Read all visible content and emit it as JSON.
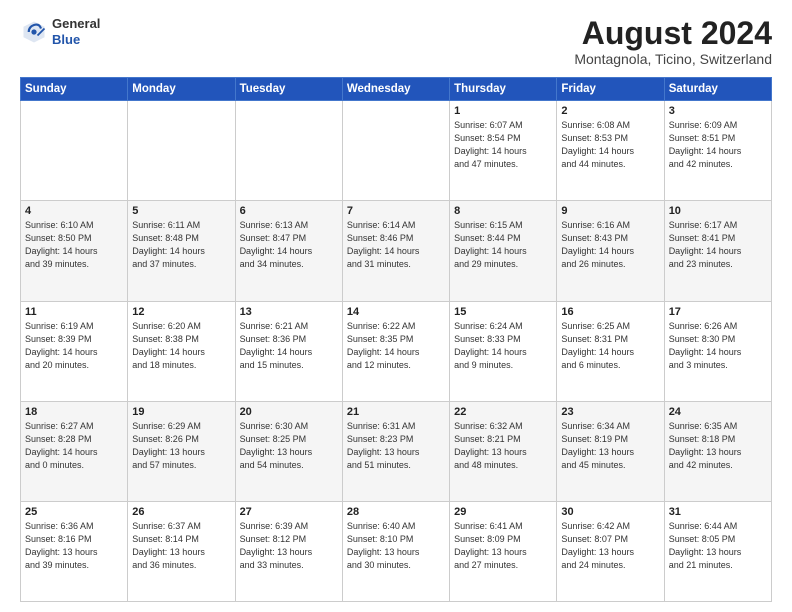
{
  "header": {
    "logo_general": "General",
    "logo_blue": "Blue",
    "month_title": "August 2024",
    "location": "Montagnola, Ticino, Switzerland"
  },
  "days_of_week": [
    "Sunday",
    "Monday",
    "Tuesday",
    "Wednesday",
    "Thursday",
    "Friday",
    "Saturday"
  ],
  "weeks": [
    [
      {
        "day": "",
        "info": ""
      },
      {
        "day": "",
        "info": ""
      },
      {
        "day": "",
        "info": ""
      },
      {
        "day": "",
        "info": ""
      },
      {
        "day": "1",
        "info": "Sunrise: 6:07 AM\nSunset: 8:54 PM\nDaylight: 14 hours\nand 47 minutes."
      },
      {
        "day": "2",
        "info": "Sunrise: 6:08 AM\nSunset: 8:53 PM\nDaylight: 14 hours\nand 44 minutes."
      },
      {
        "day": "3",
        "info": "Sunrise: 6:09 AM\nSunset: 8:51 PM\nDaylight: 14 hours\nand 42 minutes."
      }
    ],
    [
      {
        "day": "4",
        "info": "Sunrise: 6:10 AM\nSunset: 8:50 PM\nDaylight: 14 hours\nand 39 minutes."
      },
      {
        "day": "5",
        "info": "Sunrise: 6:11 AM\nSunset: 8:48 PM\nDaylight: 14 hours\nand 37 minutes."
      },
      {
        "day": "6",
        "info": "Sunrise: 6:13 AM\nSunset: 8:47 PM\nDaylight: 14 hours\nand 34 minutes."
      },
      {
        "day": "7",
        "info": "Sunrise: 6:14 AM\nSunset: 8:46 PM\nDaylight: 14 hours\nand 31 minutes."
      },
      {
        "day": "8",
        "info": "Sunrise: 6:15 AM\nSunset: 8:44 PM\nDaylight: 14 hours\nand 29 minutes."
      },
      {
        "day": "9",
        "info": "Sunrise: 6:16 AM\nSunset: 8:43 PM\nDaylight: 14 hours\nand 26 minutes."
      },
      {
        "day": "10",
        "info": "Sunrise: 6:17 AM\nSunset: 8:41 PM\nDaylight: 14 hours\nand 23 minutes."
      }
    ],
    [
      {
        "day": "11",
        "info": "Sunrise: 6:19 AM\nSunset: 8:39 PM\nDaylight: 14 hours\nand 20 minutes."
      },
      {
        "day": "12",
        "info": "Sunrise: 6:20 AM\nSunset: 8:38 PM\nDaylight: 14 hours\nand 18 minutes."
      },
      {
        "day": "13",
        "info": "Sunrise: 6:21 AM\nSunset: 8:36 PM\nDaylight: 14 hours\nand 15 minutes."
      },
      {
        "day": "14",
        "info": "Sunrise: 6:22 AM\nSunset: 8:35 PM\nDaylight: 14 hours\nand 12 minutes."
      },
      {
        "day": "15",
        "info": "Sunrise: 6:24 AM\nSunset: 8:33 PM\nDaylight: 14 hours\nand 9 minutes."
      },
      {
        "day": "16",
        "info": "Sunrise: 6:25 AM\nSunset: 8:31 PM\nDaylight: 14 hours\nand 6 minutes."
      },
      {
        "day": "17",
        "info": "Sunrise: 6:26 AM\nSunset: 8:30 PM\nDaylight: 14 hours\nand 3 minutes."
      }
    ],
    [
      {
        "day": "18",
        "info": "Sunrise: 6:27 AM\nSunset: 8:28 PM\nDaylight: 14 hours\nand 0 minutes."
      },
      {
        "day": "19",
        "info": "Sunrise: 6:29 AM\nSunset: 8:26 PM\nDaylight: 13 hours\nand 57 minutes."
      },
      {
        "day": "20",
        "info": "Sunrise: 6:30 AM\nSunset: 8:25 PM\nDaylight: 13 hours\nand 54 minutes."
      },
      {
        "day": "21",
        "info": "Sunrise: 6:31 AM\nSunset: 8:23 PM\nDaylight: 13 hours\nand 51 minutes."
      },
      {
        "day": "22",
        "info": "Sunrise: 6:32 AM\nSunset: 8:21 PM\nDaylight: 13 hours\nand 48 minutes."
      },
      {
        "day": "23",
        "info": "Sunrise: 6:34 AM\nSunset: 8:19 PM\nDaylight: 13 hours\nand 45 minutes."
      },
      {
        "day": "24",
        "info": "Sunrise: 6:35 AM\nSunset: 8:18 PM\nDaylight: 13 hours\nand 42 minutes."
      }
    ],
    [
      {
        "day": "25",
        "info": "Sunrise: 6:36 AM\nSunset: 8:16 PM\nDaylight: 13 hours\nand 39 minutes."
      },
      {
        "day": "26",
        "info": "Sunrise: 6:37 AM\nSunset: 8:14 PM\nDaylight: 13 hours\nand 36 minutes."
      },
      {
        "day": "27",
        "info": "Sunrise: 6:39 AM\nSunset: 8:12 PM\nDaylight: 13 hours\nand 33 minutes."
      },
      {
        "day": "28",
        "info": "Sunrise: 6:40 AM\nSunset: 8:10 PM\nDaylight: 13 hours\nand 30 minutes."
      },
      {
        "day": "29",
        "info": "Sunrise: 6:41 AM\nSunset: 8:09 PM\nDaylight: 13 hours\nand 27 minutes."
      },
      {
        "day": "30",
        "info": "Sunrise: 6:42 AM\nSunset: 8:07 PM\nDaylight: 13 hours\nand 24 minutes."
      },
      {
        "day": "31",
        "info": "Sunrise: 6:44 AM\nSunset: 8:05 PM\nDaylight: 13 hours\nand 21 minutes."
      }
    ]
  ]
}
